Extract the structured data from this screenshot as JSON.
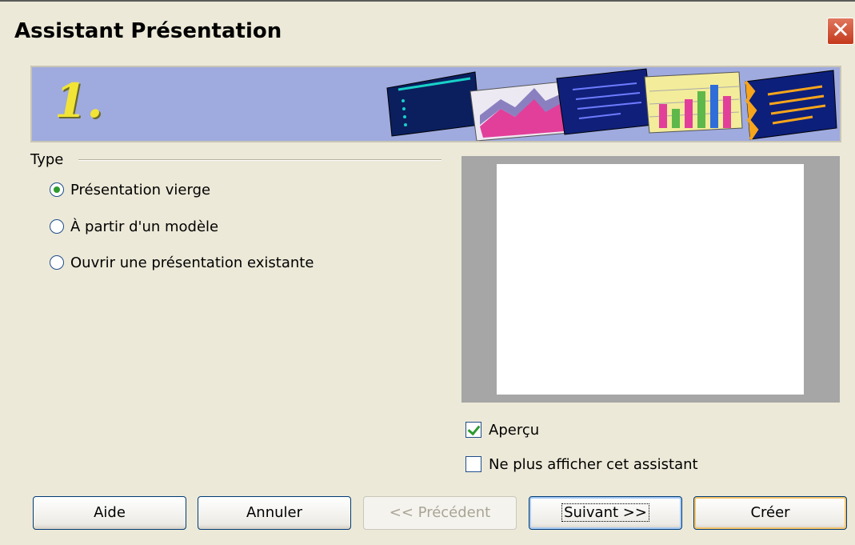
{
  "window": {
    "title": "Assistant Présentation",
    "close_glyph": "✕"
  },
  "banner": {
    "step": "1.",
    "thumbnail_icons": [
      "slide-list-icon",
      "chart-area-icon",
      "slide-bullets-icon",
      "bar-chart-icon",
      "slide-text-icon"
    ]
  },
  "type_group": {
    "label": "Type",
    "options": [
      {
        "label": "Présentation vierge",
        "selected": true
      },
      {
        "label": "À partir d'un modèle",
        "selected": false
      },
      {
        "label": "Ouvrir une présentation existante",
        "selected": false
      }
    ]
  },
  "preview": {
    "checkbox_label": "Aperçu",
    "checked": true
  },
  "no_show": {
    "checkbox_label": "Ne plus afficher cet assistant",
    "checked": false
  },
  "buttons": {
    "help": "Aide",
    "cancel": "Annuler",
    "previous": "<< Précédent",
    "next": "Suivant >>",
    "create": "Créer"
  },
  "colors": {
    "dialog_bg": "#ece9d8",
    "banner_bg": "#9faadf",
    "accent_yellow": "#f2e436",
    "close_red": "#c4391c"
  }
}
